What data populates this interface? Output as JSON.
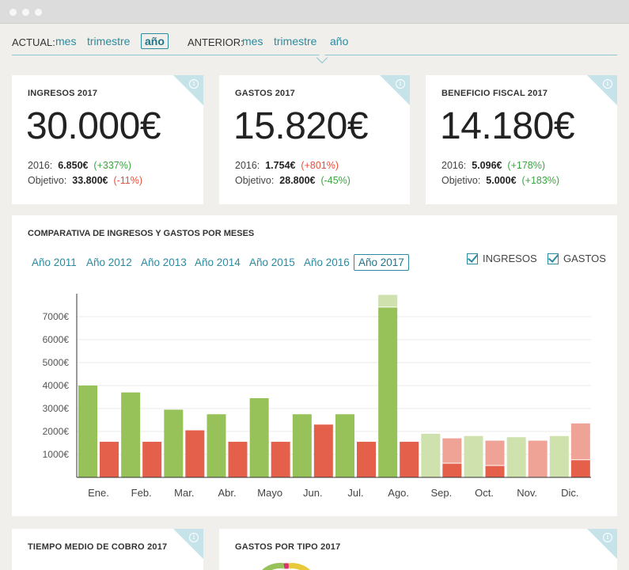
{
  "period": {
    "actual_label": "ACTUAL:",
    "actual_options": [
      "mes",
      "trimestre",
      "año"
    ],
    "actual_selected": "año",
    "anterior_label": "ANTERIOR:",
    "anterior_options": [
      "mes",
      "trimestre",
      "año"
    ]
  },
  "cards": [
    {
      "title": "INGRESOS 2017",
      "value": "30.000€",
      "prev_label": "2016:",
      "prev_value": "6.850€",
      "prev_delta": "(+337%)",
      "prev_delta_status": "positive",
      "obj_label": "Objetivo:",
      "obj_value": "33.800€",
      "obj_delta": "(-11%)",
      "obj_delta_status": "negative"
    },
    {
      "title": "GASTOS 2017",
      "value": "15.820€",
      "prev_label": "2016:",
      "prev_value": "1.754€",
      "prev_delta": "(+801%)",
      "prev_delta_status": "negative",
      "obj_label": "Objetivo:",
      "obj_value": "28.800€",
      "obj_delta": "(-45%)",
      "obj_delta_status": "positive"
    },
    {
      "title": "BENEFICIO FISCAL 2017",
      "value": "14.180€",
      "prev_label": "2016:",
      "prev_value": "5.096€",
      "prev_delta": "(+178%)",
      "prev_delta_status": "positive",
      "obj_label": "Objetivo:",
      "obj_value": "5.000€",
      "obj_delta": "(+183%)",
      "obj_delta_status": "positive"
    }
  ],
  "info_icon_glyph": "i",
  "comparativa": {
    "title": "COMPARATIVA DE INGRESOS Y GASTOS POR MESES",
    "years": [
      "Año 2011",
      "Año 2012",
      "Año 2013",
      "Año 2014",
      "Año 2015",
      "Año 2016",
      "Año 2017"
    ],
    "selected_year": "Año 2017",
    "legend": [
      {
        "label": "INGRESOS",
        "checked": true
      },
      {
        "label": "GASTOS",
        "checked": true
      }
    ]
  },
  "chart_data": {
    "type": "bar",
    "title": "COMPARATIVA DE INGRESOS Y GASTOS POR MESES",
    "categories": [
      "Ene.",
      "Feb.",
      "Mar.",
      "Abr.",
      "Mayo",
      "Jun.",
      "Jul.",
      "Ago.",
      "Sep.",
      "Oct.",
      "Nov.",
      "Dic."
    ],
    "series": [
      {
        "name": "INGRESOS",
        "values": [
          4000,
          3700,
          2950,
          2750,
          3450,
          2750,
          2750,
          7400,
          1900,
          1800,
          1750,
          1800
        ],
        "projected": [
          0,
          0,
          0,
          0,
          0,
          0,
          0,
          550,
          0,
          0,
          0,
          0
        ],
        "color": "#97c25a",
        "light_color": "#cfe2ad"
      },
      {
        "name": "GASTOS",
        "values": [
          1550,
          1550,
          2050,
          1550,
          1550,
          2300,
          1550,
          1550,
          600,
          500,
          0,
          750
        ],
        "projected": [
          0,
          0,
          0,
          0,
          0,
          0,
          0,
          0,
          1100,
          1100,
          1600,
          1600
        ],
        "color": "#e4604b",
        "light_color": "#efa396"
      }
    ],
    "future_from_index": 8,
    "yticks": [
      "1000€",
      "2000€",
      "3000€",
      "4000€",
      "5000€",
      "6000€",
      "7000€"
    ],
    "ylim": [
      0,
      8000
    ],
    "grid": true
  },
  "bottom_cards": [
    {
      "title": "TIEMPO MEDIO DE COBRO 2017"
    },
    {
      "title": "GASTOS POR TIPO 2017"
    }
  ]
}
